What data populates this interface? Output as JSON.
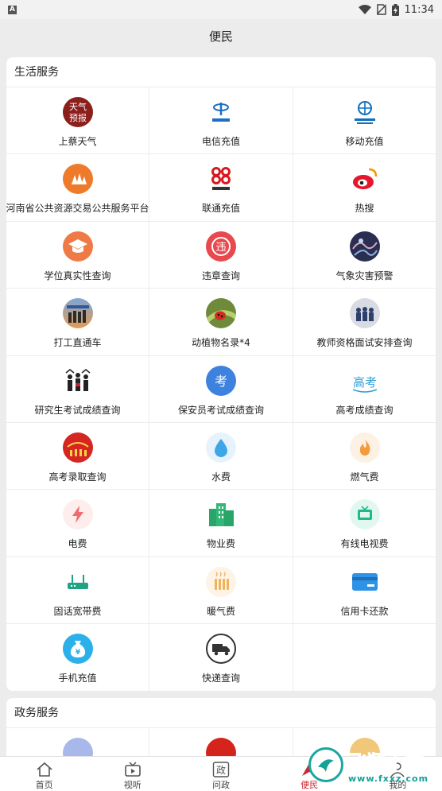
{
  "status": {
    "left_badge": "A",
    "time": "11:34"
  },
  "header": {
    "title": "便民"
  },
  "life": {
    "title": "生活服务",
    "items": [
      {
        "label": "上蔡天气",
        "icon": "weather-forecast-icon",
        "icon_text": "天气预报"
      },
      {
        "label": "电信充值",
        "icon": "china-telecom-icon",
        "icon_text": "中国电信"
      },
      {
        "label": "移动充值",
        "icon": "china-mobile-icon",
        "icon_text": "中国移动通信"
      },
      {
        "label": "河南省公共资源交易公共服务平台",
        "icon": "public-resource-icon"
      },
      {
        "label": "联通充值",
        "icon": "china-unicom-icon",
        "icon_text": "中国联通"
      },
      {
        "label": "热搜",
        "icon": "weibo-icon"
      },
      {
        "label": "学位真实性查询",
        "icon": "graduation-cap-icon"
      },
      {
        "label": "违章查询",
        "icon": "traffic-violation-icon",
        "icon_text": "违"
      },
      {
        "label": "气象灾害预警",
        "icon": "weather-warning-icon"
      },
      {
        "label": "打工直通车",
        "icon": "workers-photo-icon"
      },
      {
        "label": "动植物名录*4",
        "icon": "ladybug-photo-icon"
      },
      {
        "label": "教师资格面试安排查询",
        "icon": "teachers-photo-icon"
      },
      {
        "label": "研究生考试成绩查询",
        "icon": "graduates-icon"
      },
      {
        "label": "保安员考试成绩查询",
        "icon": "exam-icon",
        "icon_text": "考"
      },
      {
        "label": "高考成绩查询",
        "icon": "gaokao-icon",
        "icon_text": "高考"
      },
      {
        "label": "高考录取查询",
        "icon": "admission-icon"
      },
      {
        "label": "水费",
        "icon": "water-drop-icon"
      },
      {
        "label": "燃气费",
        "icon": "gas-flame-icon"
      },
      {
        "label": "电费",
        "icon": "lightning-icon"
      },
      {
        "label": "物业费",
        "icon": "buildings-icon"
      },
      {
        "label": "有线电视费",
        "icon": "tv-icon"
      },
      {
        "label": "固话宽带费",
        "icon": "router-icon"
      },
      {
        "label": "暖气费",
        "icon": "heating-icon"
      },
      {
        "label": "信用卡还款",
        "icon": "credit-card-icon"
      },
      {
        "label": "手机充值",
        "icon": "money-bag-icon"
      },
      {
        "label": "快递查询",
        "icon": "delivery-truck-icon"
      }
    ]
  },
  "gov": {
    "title": "政务服务"
  },
  "tabs": [
    {
      "label": "首页",
      "icon": "home-icon"
    },
    {
      "label": "视听",
      "icon": "tv-tab-icon"
    },
    {
      "label": "问政",
      "icon": "zheng-icon",
      "icon_text": "政"
    },
    {
      "label": "便民",
      "icon": "convenience-icon",
      "active": true
    },
    {
      "label": "我的",
      "icon": "profile-icon"
    }
  ],
  "watermark": {
    "brand": "飞翔下载",
    "url": "www.fxxz.com"
  }
}
